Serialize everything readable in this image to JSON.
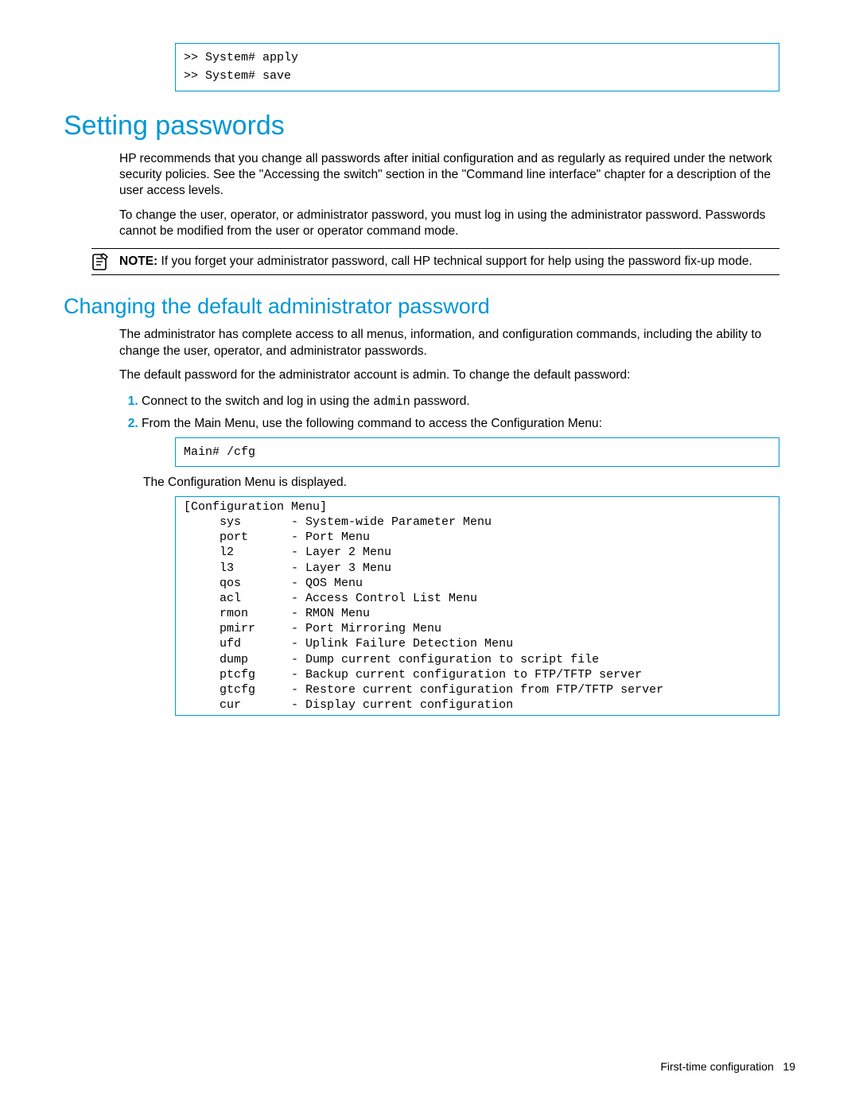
{
  "codeTop": ">> System# apply\n>> System# save",
  "h1": "Setting passwords",
  "para1": "HP recommends that you change all passwords after initial configuration and as regularly as required under the network security policies. See the \"Accessing the switch\" section in the \"Command line interface\" chapter for a description of the user access levels.",
  "para2": "To change the user, operator, or administrator password, you must log in using the administrator password. Passwords cannot be modified from the user or operator command mode.",
  "note": {
    "label": "NOTE:",
    "text": "  If you forget your administrator password, call HP technical support for help using the password fix-up mode."
  },
  "h2": "Changing the default administrator password",
  "para3": "The administrator has complete access to all menus, information, and configuration commands, including the ability to change the user, operator, and administrator passwords.",
  "para4": "The default password for the administrator account is admin. To change the default password:",
  "steps": {
    "s1a": "Connect to the switch and log in using the ",
    "s1b": "admin",
    "s1c": " password.",
    "s2": "From the Main Menu, use the following command to access the Configuration Menu:"
  },
  "codeCfg": "Main# /cfg",
  "afterCfg": "The Configuration Menu is displayed.",
  "codeMenu": "[Configuration Menu]\n     sys       - System-wide Parameter Menu\n     port      - Port Menu\n     l2        - Layer 2 Menu\n     l3        - Layer 3 Menu\n     qos       - QOS Menu\n     acl       - Access Control List Menu\n     rmon      - RMON Menu\n     pmirr     - Port Mirroring Menu\n     ufd       - Uplink Failure Detection Menu\n     dump      - Dump current configuration to script file\n     ptcfg     - Backup current configuration to FTP/TFTP server\n     gtcfg     - Restore current configuration from FTP/TFTP server\n     cur       - Display current configuration",
  "footer": {
    "section": "First-time configuration",
    "page": "19"
  }
}
